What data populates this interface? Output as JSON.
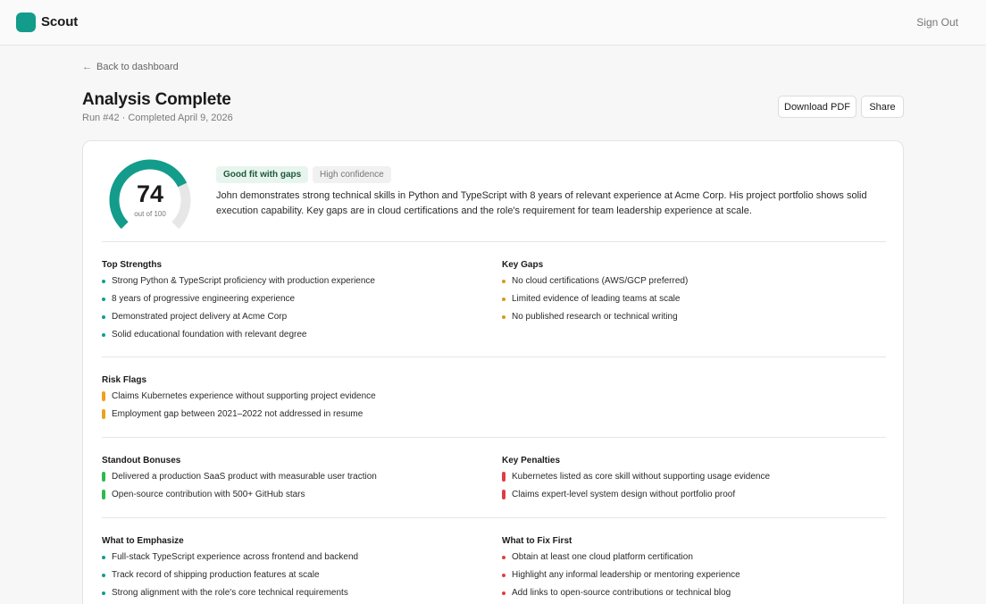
{
  "app": {
    "name": "Scout",
    "sign_out": "Sign Out"
  },
  "colors": {
    "accent": "#139c8b",
    "amber": "#d49a1d",
    "orange": "#f0a01c",
    "green": "#2fb94c",
    "red": "#df3d44"
  },
  "nav": {
    "back_label": "Back to dashboard"
  },
  "header": {
    "title": "Analysis Complete",
    "subtitle": "Run #42 · Completed April 9, 2026",
    "download_label": "Download PDF",
    "share_label": "Share"
  },
  "score": {
    "value": "74",
    "out_of": "out of 100",
    "fraction": 0.74,
    "fit_badge": "Good fit with gaps",
    "confidence_badge": "High confidence",
    "summary": "John demonstrates strong technical skills in Python and TypeScript with 8 years of relevant experience at Acme Corp. His project portfolio shows solid execution capability. Key gaps are in cloud certifications and the role's requirement for team leadership experience at scale."
  },
  "strengths": {
    "title": "Top Strengths",
    "items": [
      "Strong Python & TypeScript proficiency with production experience",
      "8 years of progressive engineering experience",
      "Demonstrated project delivery at Acme Corp",
      "Solid educational foundation with relevant degree"
    ]
  },
  "gaps": {
    "title": "Key Gaps",
    "items": [
      "No cloud certifications (AWS/GCP preferred)",
      "Limited evidence of leading teams at scale",
      "No published research or technical writing"
    ]
  },
  "risks": {
    "title": "Risk Flags",
    "items": [
      "Claims Kubernetes experience without supporting project evidence",
      "Employment gap between 2021–2022 not addressed in resume"
    ]
  },
  "bonuses": {
    "title": "Standout Bonuses",
    "items": [
      "Delivered a production SaaS product with measurable user traction",
      "Open-source contribution with 500+ GitHub stars"
    ]
  },
  "penalties": {
    "title": "Key Penalties",
    "items": [
      "Kubernetes listed as core skill without supporting usage evidence",
      "Claims expert-level system design without portfolio proof"
    ]
  },
  "emphasize": {
    "title": "What to Emphasize",
    "items": [
      "Full-stack TypeScript experience across frontend and backend",
      "Track record of shipping production features at scale",
      "Strong alignment with the role's core technical requirements"
    ]
  },
  "fix_first": {
    "title": "What to Fix First",
    "items": [
      "Obtain at least one cloud platform certification",
      "Highlight any informal leadership or mentoring experience",
      "Add links to open-source contributions or technical blog"
    ]
  }
}
